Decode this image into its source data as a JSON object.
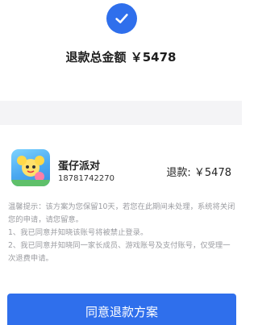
{
  "header": {
    "total_label": "退款总金额 ￥5478"
  },
  "game": {
    "name": "蛋仔派对",
    "phone": "18781742270",
    "refund_label": "退款: ￥5478"
  },
  "notice": {
    "lines": [
      "温馨提示：该方案为您保留10天，若您在此期间未处理，系统将关闭您的申请，请您留意。",
      "1、我已同意并知晓该账号将被禁止登录。",
      "2、我已同意并知晓同一家长成员、游戏账号及支付账号，仅受理一次退费申请。"
    ]
  },
  "actions": {
    "agree_label": "同意退款方案"
  },
  "colors": {
    "accent": "#2f6fec",
    "muted_text": "#9b9ca1",
    "band": "#f4f4f6"
  }
}
